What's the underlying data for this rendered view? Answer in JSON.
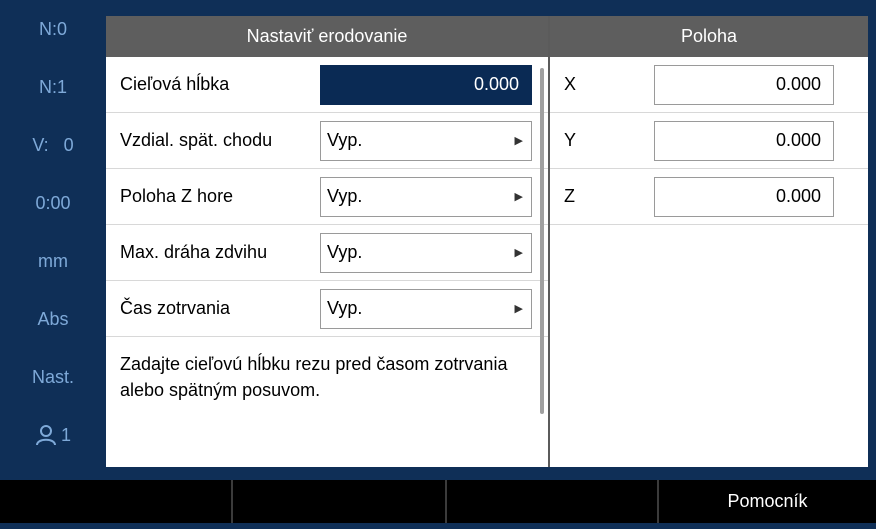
{
  "sidebar": {
    "items": [
      "N:0",
      "N:1",
      "V:   0",
      "0:00",
      "mm",
      "Abs",
      "Nast."
    ],
    "user_count": "1"
  },
  "setup_panel": {
    "title": "Nastaviť erodovanie",
    "rows": [
      {
        "label": "Cieľová hĺbka",
        "value": "0.000"
      },
      {
        "label": "Vzdial. spät. chodu",
        "value": "Vyp."
      },
      {
        "label": "Poloha Z hore",
        "value": "Vyp."
      },
      {
        "label": "Max. dráha zdvihu",
        "value": "Vyp."
      },
      {
        "label": "Čas zotrvania",
        "value": "Vyp."
      }
    ],
    "description": "Zadajte cieľovú hĺbku rezu pred časom zotrvania alebo spätným posuvom."
  },
  "position_panel": {
    "title": "Poloha",
    "axes": [
      {
        "axis": "X",
        "value": "0.000"
      },
      {
        "axis": "Y",
        "value": "0.000"
      },
      {
        "axis": "Z",
        "value": "0.000"
      }
    ]
  },
  "softkeys": [
    "",
    "",
    "",
    "Pomocník"
  ],
  "icons": {
    "user": "user-icon",
    "arrow": "triangle-right-icon"
  },
  "colors": {
    "background": "#0f2f57",
    "selected_field": "#0a2a54",
    "header": "#5e5e5e",
    "sidebar_text": "#7ea9d8"
  }
}
